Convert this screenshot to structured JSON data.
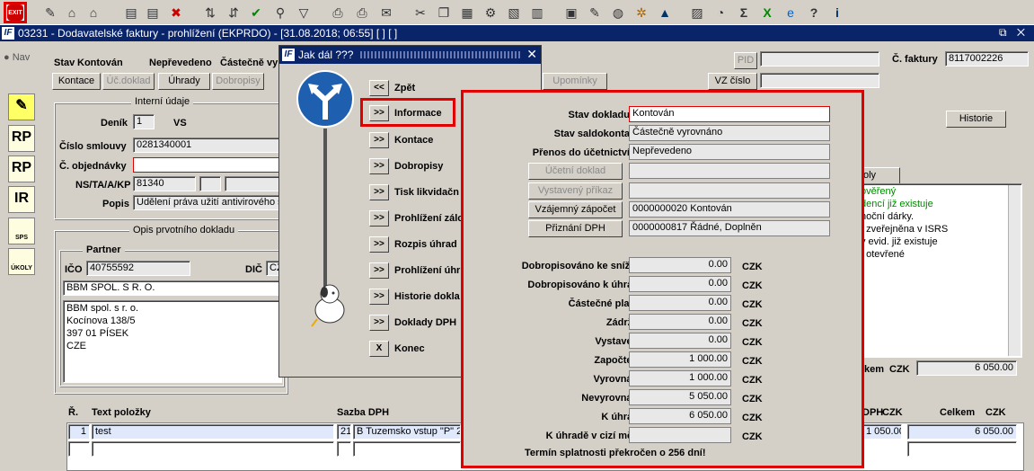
{
  "toolbar": {
    "exit_label": "EXIT",
    "icons": [
      "new-icon",
      "home-icon",
      "home-edit-icon",
      "doc-icon",
      "doc-edit-icon",
      "doc-delete-icon",
      "sort-asc-icon",
      "sort-desc-icon",
      "check-icon",
      "wrench-icon",
      "filter-icon",
      "print-icon",
      "print-preview-icon",
      "mail-icon",
      "cut-icon",
      "copy-icon",
      "paste-icon",
      "tools-icon",
      "doc-find-icon",
      "grid-icon",
      "calc-icon",
      "edit-icon",
      "globe-icon",
      "settings-icon",
      "warning-icon",
      "chart-icon",
      "clock-icon",
      "sum-icon",
      "excel-icon",
      "browser-icon",
      "help-icon",
      "info-icon"
    ]
  },
  "window": {
    "title": "03231 - Dodavatelské faktury - prohlížení (EKPRDO) - [31.08.2018; 06:55] [ ] [ ]",
    "controls": "⧉ ✕"
  },
  "header": {
    "nav_label": "Nav",
    "stav_label": "Stav",
    "stav_value": "Kontován",
    "neprevedeno": "Nepřevedeno",
    "castecne": "Částečně vy",
    "pid_label": "PID",
    "faktura_label": "Č. faktury",
    "faktura_value": "8117002226",
    "vz_label": "VZ číslo"
  },
  "buttons": {
    "kontace": "Kontace",
    "uc_doklad": "Úč.doklad",
    "uhrady": "Úhrady",
    "dobropisy": "Dobropisy",
    "upominky": "Upomínky",
    "historie": "Historie"
  },
  "sidebar_icons": [
    "RP",
    "RP",
    "IR",
    "SPS",
    "ÚKOLY"
  ],
  "interni": {
    "group_label": "Interní údaje",
    "denik_label": "Deník",
    "denik_value": "1",
    "denik_suffix": "VS",
    "smlouva_label": "Číslo smlouvy",
    "smlouva_value": "0281340001",
    "objednavka_label": "Č. objednávky",
    "objednavka_value": "",
    "ns_label": "NS/TA/A/KP",
    "ns_value": "81340",
    "popis_label": "Popis",
    "popis_value": "Udělení práva užití antivirového s"
  },
  "opis": {
    "group_label": "Opis prvotního dokladu",
    "partner_label": "Partner",
    "ico_label": "IČO",
    "ico_value": "40755592",
    "dic_label": "DIČ",
    "dic_value": "CZ",
    "partner_name": "BBM SPOL. S R. O.",
    "address": [
      "BBM spol. s r. o.",
      "Kocínova 138/5",
      "397 01 PÍSEK",
      "CZE"
    ]
  },
  "items": {
    "col_r": "Ř.",
    "col_text": "Text položky",
    "col_sazba": "Sazba DPH",
    "col_dph": "DPH",
    "col_czk1": "CZK",
    "col_celkem": "Celkem",
    "col_czk2": "CZK",
    "row": {
      "r": "1",
      "text": "test",
      "sazba": "21",
      "sazba_text": "B  Tuzemsko vstup \"P\" 2",
      "dph": "1 050.00",
      "celkem": "6 050.00"
    }
  },
  "right": {
    "tab_label": "oly",
    "messages": [
      "ověřený",
      "dencí již existuje",
      "noční dárky.",
      "í zveřejněna v ISRS",
      "v evid. již existuje",
      "í otevřené"
    ],
    "celkem_label": "kem",
    "celkem_cur": "CZK",
    "celkem_value": "6 050.00"
  },
  "dialog": {
    "title": "Jak dál ???",
    "options": [
      {
        "btn": "<<",
        "label": "Zpět"
      },
      {
        "btn": ">>",
        "label": "Informace"
      },
      {
        "btn": ">>",
        "label": "Kontace"
      },
      {
        "btn": ">>",
        "label": "Dobropisy"
      },
      {
        "btn": ">>",
        "label": "Tisk likvidačn"
      },
      {
        "btn": ">>",
        "label": "Prohlížení zálo"
      },
      {
        "btn": ">>",
        "label": "Rozpis úhrad"
      },
      {
        "btn": ">>",
        "label": "Prohlížení úhr"
      },
      {
        "btn": ">>",
        "label": "Historie dokla"
      },
      {
        "btn": ">>",
        "label": "Doklady DPH"
      },
      {
        "btn": "X",
        "label": "Konec"
      }
    ]
  },
  "info": {
    "stav_dokladu_label": "Stav dokladu",
    "stav_dokladu": "Kontován",
    "stav_saldokonta_label": "Stav saldokonta",
    "stav_saldokonta": "Částečně vyrovnáno",
    "prenos_label": "Přenos do účetnictví",
    "prenos": "Nepřevedeno",
    "ucetni_doklad_btn": "Účetní doklad",
    "ucetni_doklad": "",
    "vystaveny_prikaz_btn": "Vystavený příkaz",
    "vystaveny_prikaz": "",
    "vzajemny_btn": "Vzájemný zápočet",
    "vzajemny": "0000000020 Kontován",
    "priznani_btn": "Přiznání DPH",
    "priznani": "0000000817 Řádné, Doplněn",
    "amounts": [
      {
        "label": "Dobropisováno ke snížení",
        "value": "0.00",
        "cur": "CZK"
      },
      {
        "label": "Dobropisováno k úhradě",
        "value": "0.00",
        "cur": "CZK"
      },
      {
        "label": "Částečné platby",
        "value": "0.00",
        "cur": "CZK"
      },
      {
        "label": "Zádržné",
        "value": "0.00",
        "cur": "CZK"
      },
      {
        "label": "Vystaveno",
        "value": "0.00",
        "cur": "CZK"
      },
      {
        "label": "Započteno",
        "value": "1 000.00",
        "cur": "CZK"
      },
      {
        "label": "Vyrovnáno",
        "value": "1 000.00",
        "cur": "CZK"
      },
      {
        "label": "Nevyrovnáno",
        "value": "5 050.00",
        "cur": "CZK"
      },
      {
        "label": "K úhradě",
        "value": "6 050.00",
        "cur": "CZK"
      },
      {
        "label": "K úhradě v cizí měně",
        "value": "",
        "cur": "CZK"
      }
    ],
    "footer": "Termín splatnosti překročen o 256 dní!"
  }
}
